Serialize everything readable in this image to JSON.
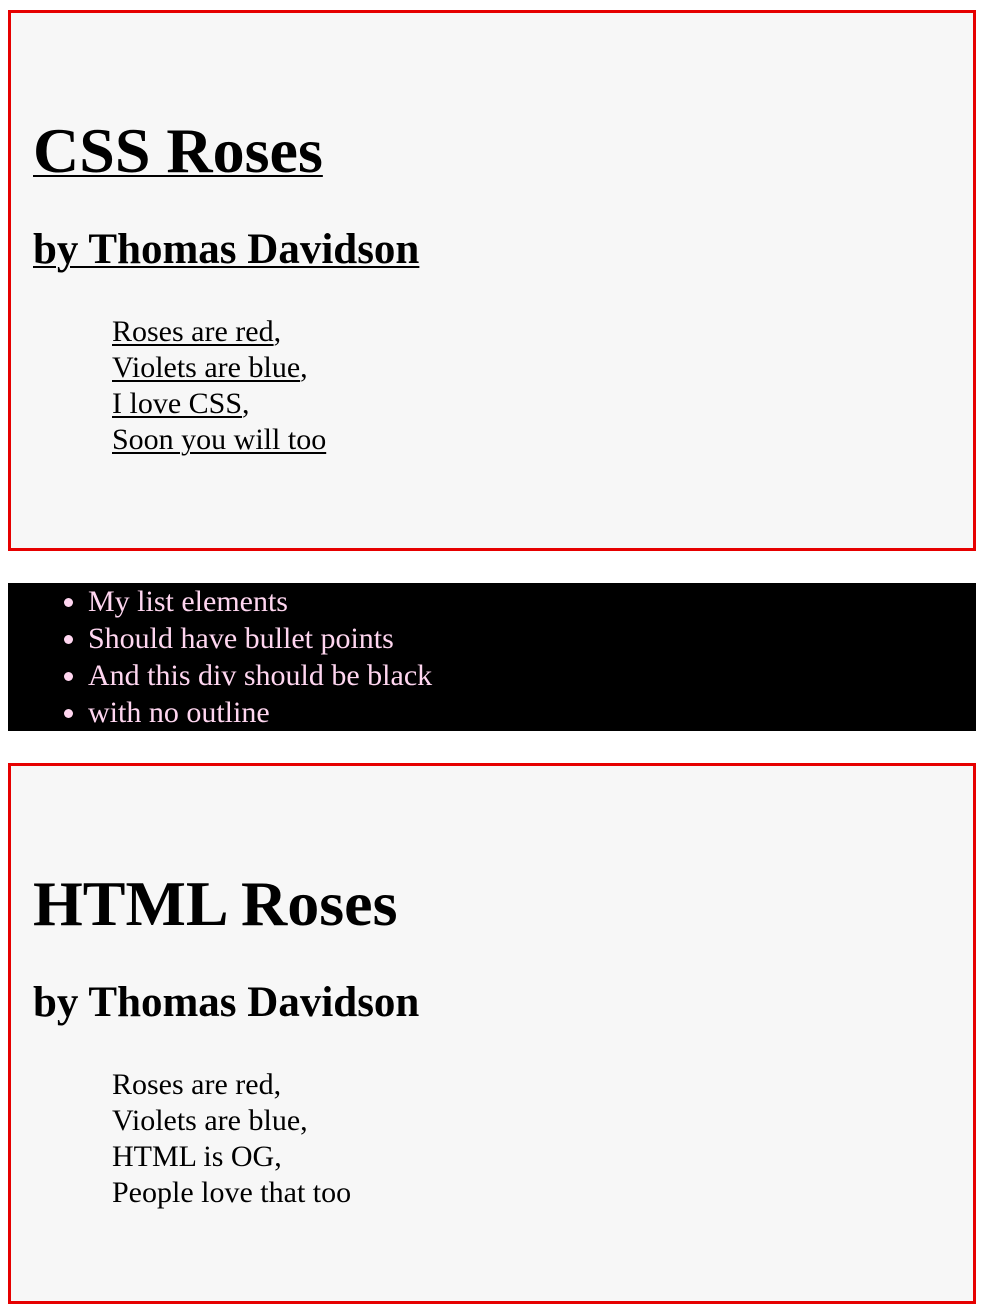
{
  "css_poem": {
    "title": "CSS Roses",
    "author": "by Thomas Davidson",
    "lines": [
      {
        "text": "Roses are red",
        "punct": ","
      },
      {
        "text": "Violets are blue",
        "punct": ","
      },
      {
        "text": "I love CSS",
        "punct": ","
      },
      {
        "text": "Soon you will too",
        "punct": ""
      }
    ]
  },
  "list": {
    "items": [
      "My list elements",
      "Should have bullet points",
      "And this div should be black",
      "with no outline"
    ]
  },
  "html_poem": {
    "title": "HTML Roses",
    "author": "by Thomas Davidson",
    "lines": [
      "Roses are red,",
      "Violets are blue,",
      "HTML is OG,",
      "People love that too"
    ]
  },
  "colors": {
    "border": "#e60000",
    "box_background": "#f7f7f7",
    "list_background": "#000000",
    "list_text": "#ffd6f0"
  }
}
